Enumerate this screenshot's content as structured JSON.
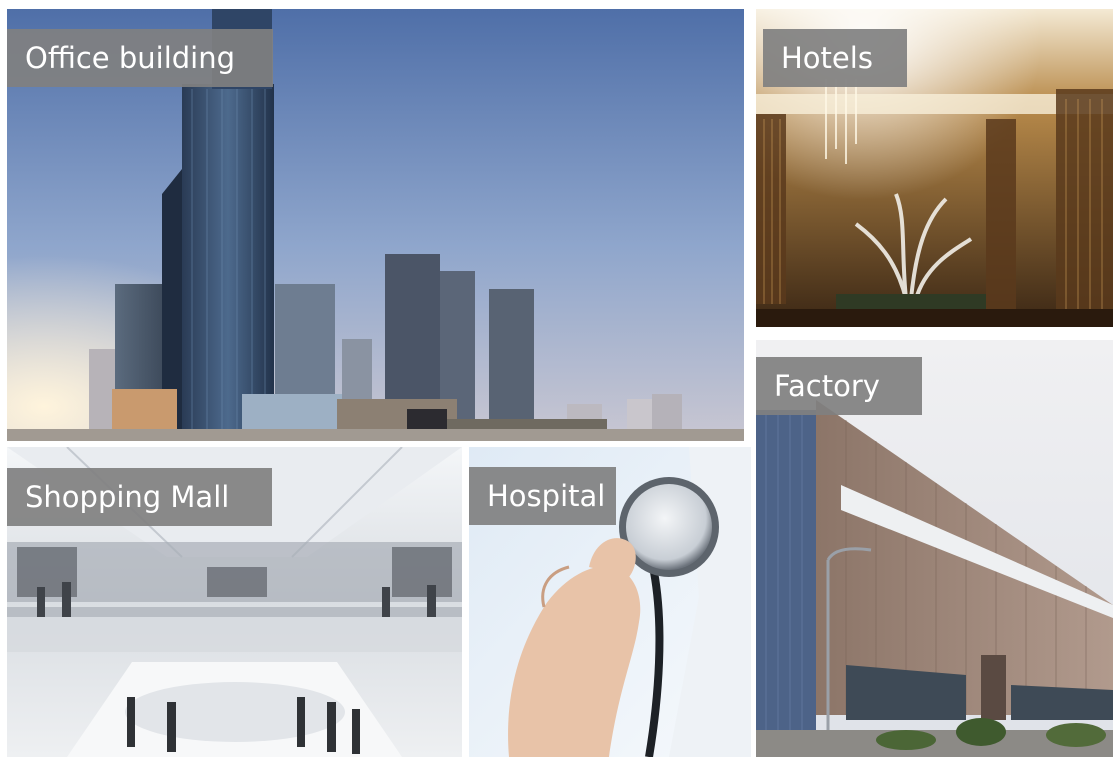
{
  "tiles": {
    "office": {
      "label": "Office building"
    },
    "hotels": {
      "label": "Hotels"
    },
    "factory": {
      "label": "Factory"
    },
    "mall": {
      "label": "Shopping Mall"
    },
    "hospital": {
      "label": "Hospital"
    }
  },
  "colors": {
    "label_bg": "#808080",
    "label_text": "#ffffff",
    "background": "#ffffff"
  }
}
